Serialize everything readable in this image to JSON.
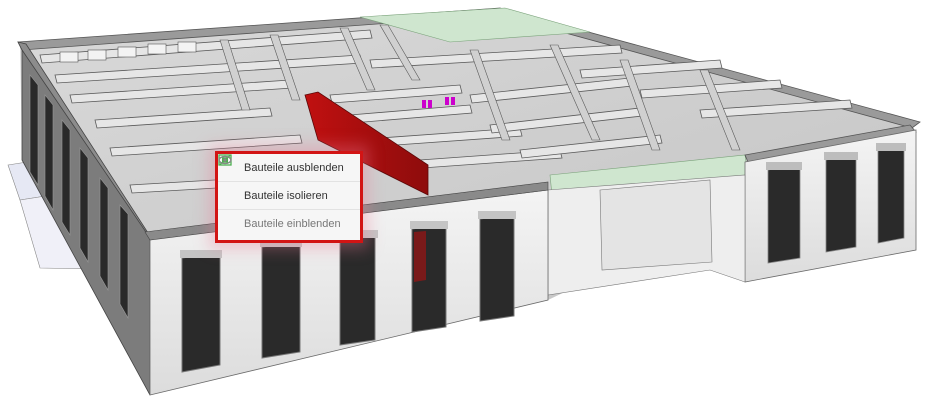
{
  "viewer": {
    "scene_name": "3d-building-model"
  },
  "context_menu": {
    "items": [
      {
        "label": "Bauteile ausblenden",
        "icon": "eye-slash-icon",
        "enabled": true
      },
      {
        "label": "Bauteile isolieren",
        "icon": "isolate-box-icon",
        "enabled": true
      },
      {
        "label": "Bauteile einblenden",
        "icon": "eye-icon",
        "enabled": false
      }
    ],
    "border_color": "#d21414",
    "icon_color": "#4caf50"
  },
  "colors": {
    "selected_wall": "#b81414",
    "window_glass": "#2a2a2a",
    "roof_glass_strip": "#c8e0c8",
    "markers": "#cc00cc"
  }
}
